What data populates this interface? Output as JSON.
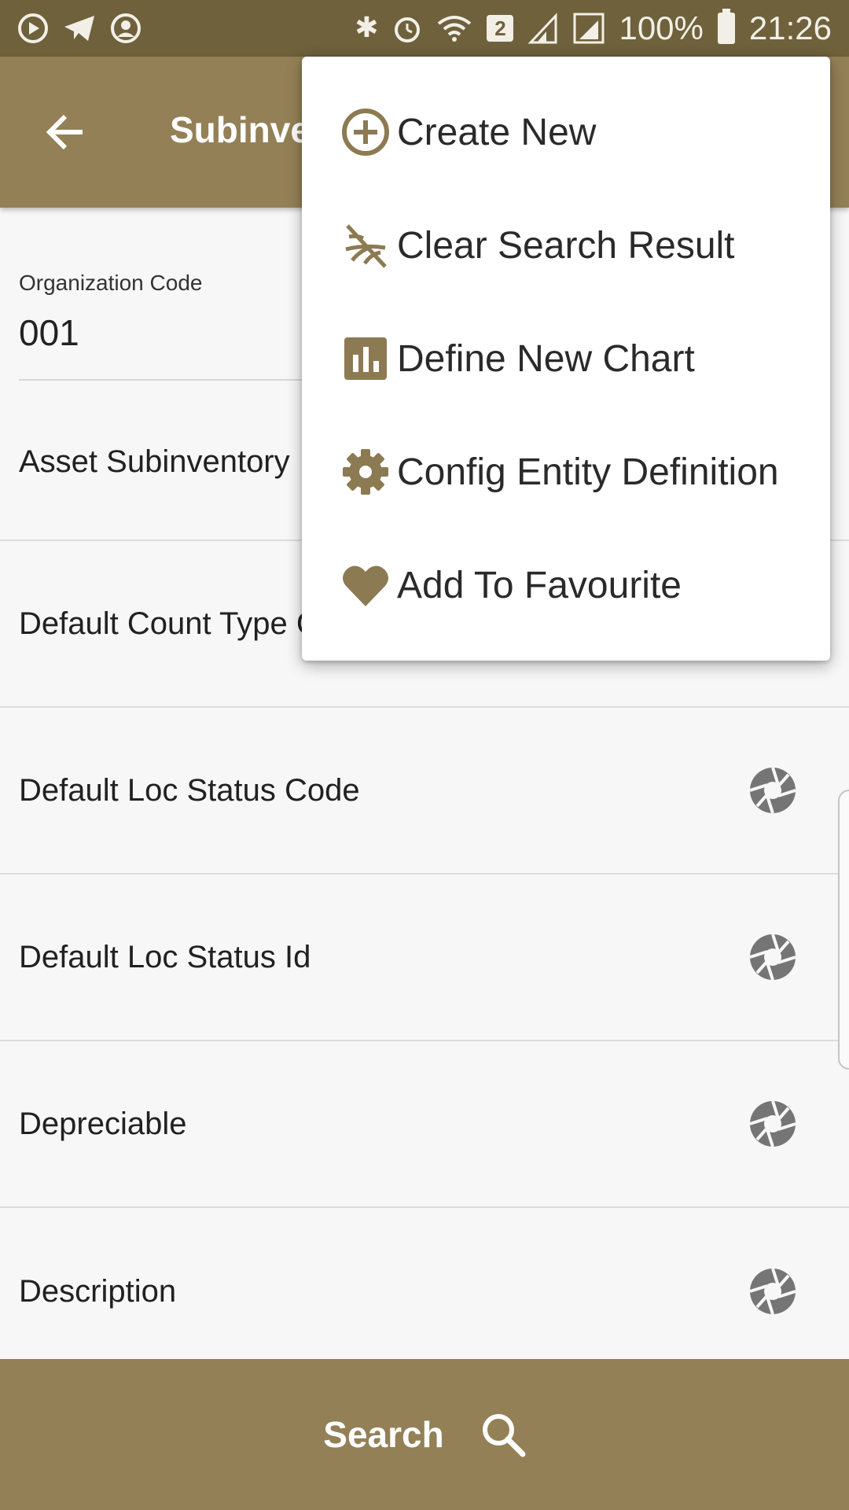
{
  "status_bar": {
    "battery": "100%",
    "time": "21:26",
    "sim_badge": "2"
  },
  "app_bar": {
    "title": "Subinventory"
  },
  "form": {
    "organization_code": {
      "label": "Organization Code",
      "value": "001"
    },
    "rows": [
      {
        "label": "Asset Subinventory"
      },
      {
        "label": "Default Count Type Code"
      },
      {
        "label": "Default Loc Status Code"
      },
      {
        "label": "Default Loc Status Id"
      },
      {
        "label": "Depreciable"
      },
      {
        "label": "Description"
      }
    ]
  },
  "bottom_bar": {
    "search_label": "Search"
  },
  "menu": {
    "items": [
      {
        "label": "Create New",
        "icon": "plus-circle-icon"
      },
      {
        "label": "Clear Search Result",
        "icon": "clear-filter-icon"
      },
      {
        "label": "Define New Chart",
        "icon": "bar-chart-icon"
      },
      {
        "label": "Config Entity Definition",
        "icon": "gear-icon"
      },
      {
        "label": "Add To Favourite",
        "icon": "heart-icon"
      }
    ]
  },
  "colors": {
    "status_bar": "#6e613c",
    "primary": "#938056",
    "menu_icon": "#8c7a52",
    "row_icon": "#757575"
  }
}
